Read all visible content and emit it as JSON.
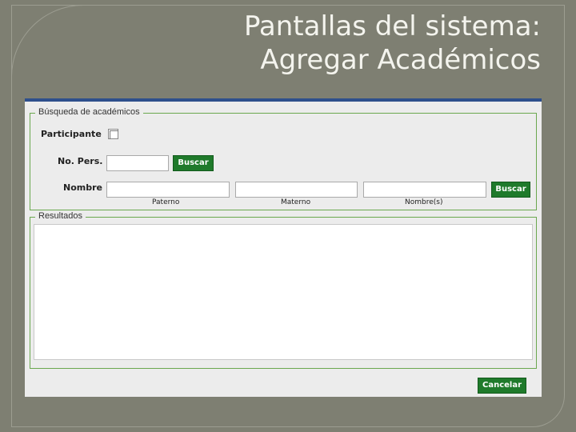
{
  "slide": {
    "title_line1": "Pantallas del sistema:",
    "title_line2": "Agregar Académicos"
  },
  "search": {
    "legend": "Búsqueda de académicos",
    "participante_label": "Participante",
    "participante_checked": false,
    "no_pers_label": "No. Pers.",
    "no_pers_value": "",
    "buscar_label_1": "Buscar",
    "nombre_label": "Nombre",
    "paterno_value": "",
    "materno_value": "",
    "nombres_value": "",
    "paterno_label": "Paterno",
    "materno_label": "Materno",
    "nombres_label": "Nombre(s)",
    "buscar_label_2": "Buscar"
  },
  "results": {
    "legend": "Resultados"
  },
  "footer": {
    "cancel_label": "Cancelar"
  },
  "colors": {
    "slide_bg": "#7e7f72",
    "title_text": "#f4f4ee",
    "window_top_bar": "#2e4f8c",
    "button_green": "#1f7a2b",
    "fieldset_border": "#6aa84f"
  }
}
